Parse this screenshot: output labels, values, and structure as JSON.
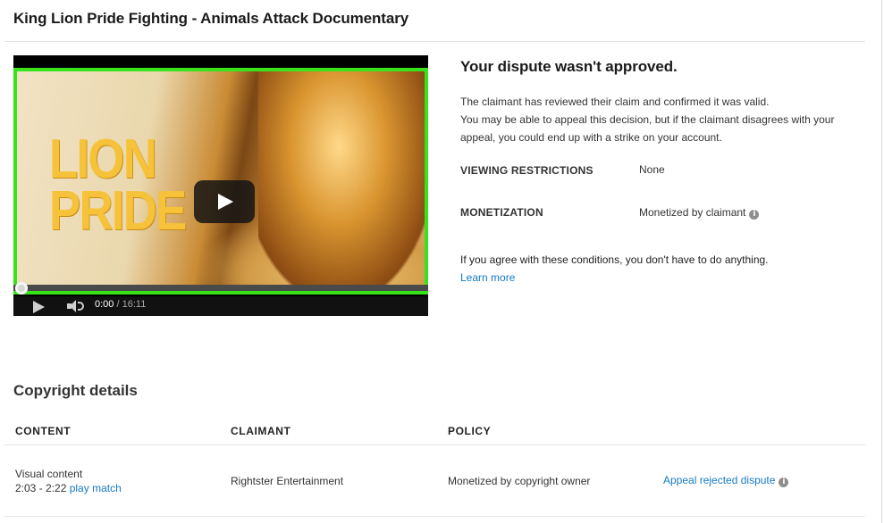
{
  "page": {
    "title": "King Lion Pride Fighting - Animals Attack Documentary"
  },
  "video": {
    "thumbnail_text_line1": "LION",
    "thumbnail_text_line2": "PRIDE",
    "current_time": "0:00",
    "duration": "/ 16:11",
    "progress_fraction": 0,
    "border_color": "#38e31c"
  },
  "dispute": {
    "title": "Your dispute wasn't approved.",
    "line1": "The claimant has reviewed their claim and confirmed it was valid.",
    "line2": "You may be able to appeal this decision, but if the claimant disagrees with your appeal, you could end up with a strike on your account.",
    "viewing_restrictions_label": "VIEWING RESTRICTIONS",
    "viewing_restrictions_value": "None",
    "monetization_label": "MONETIZATION",
    "monetization_value": "Monetized by claimant",
    "info_icon": "i",
    "agree_text": "If you agree with these conditions, you don't have to do anything.",
    "learn_more": "Learn more"
  },
  "copyright": {
    "section_title": "Copyright details",
    "headers": {
      "content": "CONTENT",
      "claimant": "CLAIMANT",
      "policy": "POLICY"
    },
    "rows": [
      {
        "content_type": "Visual content",
        "time_range": "2:03 - 2:22",
        "play_match": "play match",
        "claimant": "Rightster Entertainment",
        "policy": "Monetized by copyright owner",
        "action": "Appeal rejected dispute"
      }
    ]
  },
  "colors": {
    "link": "#167ac6",
    "thumbnail_border": "#38e31c",
    "thumbnail_text": "#f6c239"
  }
}
